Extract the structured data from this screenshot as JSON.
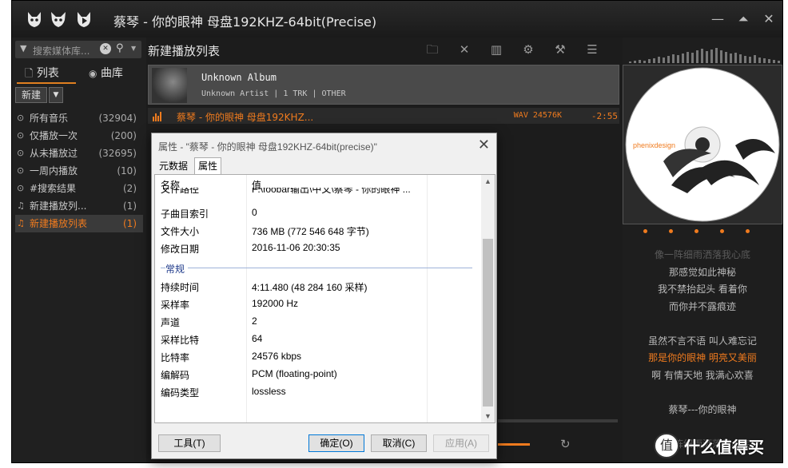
{
  "window": {
    "title": "蔡琴 - 你的眼神 母盘192KHZ-64bit(Precise)",
    "controls": [
      "minimize-icon",
      "restore-icon",
      "close-icon"
    ]
  },
  "left_panel": {
    "search_placeholder": "搜索媒体库...",
    "tab_list": "列表",
    "tab_library": "曲库",
    "new_button": "新建",
    "playlists": [
      {
        "label": "所有音乐",
        "count": "(32904)",
        "icon": "search-icon"
      },
      {
        "label": "仅播放一次",
        "count": "(200)",
        "icon": "search-icon"
      },
      {
        "label": "从未播放过",
        "count": "(32695)",
        "icon": "search-icon"
      },
      {
        "label": "一周内播放",
        "count": "(10)",
        "icon": "search-icon"
      },
      {
        "label": "#搜索结果",
        "count": "(2)",
        "icon": "search-icon"
      },
      {
        "label": "新建播放列...",
        "count": "(1)",
        "icon": "playlist-icon"
      },
      {
        "label": "新建播放列表",
        "count": "(1)",
        "icon": "playlist-icon"
      }
    ]
  },
  "center": {
    "playlist_title": "新建播放列表",
    "album": {
      "name": "Unknown Album",
      "meta": "Unknown Artist | 1 TRK | OTHER"
    },
    "track": {
      "title": "蔡琴 - 你的眼神 母盘192KHZ...",
      "format": "WAV 24576K",
      "time": "-2:55"
    }
  },
  "dialog": {
    "title": "属性 - \"蔡琴 - 你的眼神 母盘192KHZ-64bit(precise)\"",
    "tabs": [
      "元数据",
      "属性"
    ],
    "header": {
      "name": "名称",
      "value": "值"
    },
    "partial_row": {
      "key": "文件路径",
      "value": "F:\\foobar输出\\中文\\蔡琴 - 你的眼神 ..."
    },
    "rows_top": [
      {
        "key": "子曲目索引",
        "value": "0"
      },
      {
        "key": "文件大小",
        "value": "736 MB (772 546 648 字节)"
      },
      {
        "key": "修改日期",
        "value": "2016-11-06 20:30:35"
      }
    ],
    "section": "常规",
    "rows_general": [
      {
        "key": "持续时间",
        "value": "4:11.480 (48 284 160 采样)"
      },
      {
        "key": "采样率",
        "value": "192000 Hz"
      },
      {
        "key": "声道",
        "value": "2"
      },
      {
        "key": "采样比特",
        "value": "64"
      },
      {
        "key": "比特率",
        "value": "24576 kbps"
      },
      {
        "key": "编解码",
        "value": "PCM (floating-point)"
      },
      {
        "key": "编码类型",
        "value": "lossless"
      }
    ],
    "buttons": {
      "tools": "工具(T)",
      "ok": "确定(O)",
      "cancel": "取消(C)",
      "apply": "应用(A)"
    }
  },
  "right_panel": {
    "disc_brand": "phenixdesign",
    "lyrics": [
      {
        "text": "像一阵细雨洒落我心底",
        "style": "dim"
      },
      {
        "text": "那感觉如此神秘",
        "style": "normal"
      },
      {
        "text": "我不禁抬起头  看着你",
        "style": "normal"
      },
      {
        "text": "而你并不露痕迹",
        "style": "normal"
      },
      {
        "text": "",
        "style": "normal"
      },
      {
        "text": "虽然不言不语  叫人难忘记",
        "style": "normal"
      },
      {
        "text": "那是你的眼神  明亮又美丽",
        "style": "hl"
      },
      {
        "text": "啊  有情天地  我满心欢喜",
        "style": "normal"
      },
      {
        "text": "",
        "style": "normal"
      },
      {
        "text": "蔡琴---你的眼神",
        "style": "normal"
      },
      {
        "text": "",
        "style": "normal"
      },
      {
        "text": "像一阵细雨洒落我心底",
        "style": "dim"
      }
    ]
  },
  "watermark": {
    "text": "什么值得买",
    "mark": "值"
  },
  "colors": {
    "accent": "#f07b1e",
    "background": "#1b1b1b",
    "dialog": "#f0f0f0"
  }
}
